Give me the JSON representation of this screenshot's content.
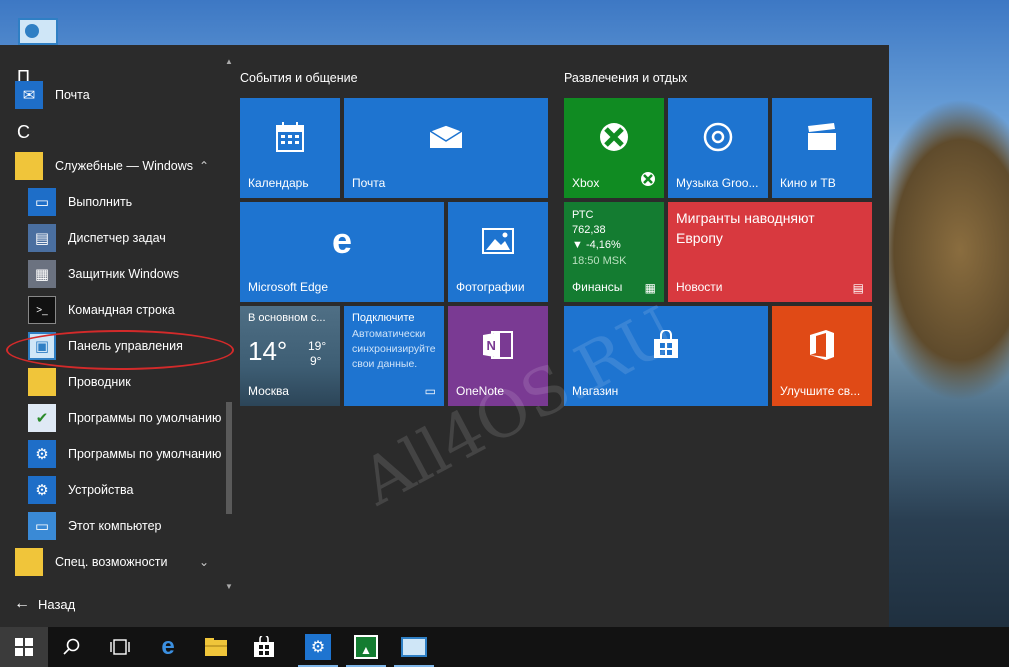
{
  "applist": {
    "letters": [
      "П",
      "С"
    ],
    "items": [
      {
        "label": "Почта",
        "icon": "mail-icon"
      },
      {
        "label": "Служебные — Windows",
        "icon": "folder-icon"
      },
      {
        "label": "Выполнить",
        "icon": "run-icon"
      },
      {
        "label": "Диспетчер задач",
        "icon": "task-manager-icon"
      },
      {
        "label": "Защитник Windows",
        "icon": "defender-icon"
      },
      {
        "label": "Командная строка",
        "icon": "cmd-icon"
      },
      {
        "label": "Панель управления",
        "icon": "control-panel-icon"
      },
      {
        "label": "Проводник",
        "icon": "explorer-icon"
      },
      {
        "label": "Программы по умолчанию",
        "icon": "default-programs-icon"
      },
      {
        "label": "Программы по умолчанию",
        "icon": "gear-icon"
      },
      {
        "label": "Устройства",
        "icon": "gear-icon"
      },
      {
        "label": "Этот компьютер",
        "icon": "computer-icon"
      },
      {
        "label": "Спец. возможности",
        "icon": "folder-icon"
      }
    ],
    "back_label": "Назад"
  },
  "groups": {
    "left_title": "События и общение",
    "right_title": "Развлечения и отдых"
  },
  "tiles": {
    "calendar": "Календарь",
    "mail": "Почта",
    "edge": "Microsoft Edge",
    "photos": "Фотографии",
    "weather": {
      "title": "В основном с...",
      "temp": "14°",
      "high": "19°",
      "low": "9°",
      "city": "Москва"
    },
    "connect": {
      "title": "Подключите",
      "text1": "Автоматически",
      "text2": "синхронизируйте",
      "text3": "свои данные."
    },
    "onenote": "OneNote",
    "xbox": "Xbox",
    "music": "Музыка Groo...",
    "movies": "Кино и ТВ",
    "finance": {
      "ticker": "РТС",
      "value": "762,38",
      "change": "▼ -4,16%",
      "time": "18:50 MSK",
      "name": "Финансы"
    },
    "news": {
      "headline": "Мигранты наводняют Европу",
      "name": "Новости"
    },
    "store": "Магазин",
    "office": "Улучшите св..."
  },
  "watermark": "All4OS.RU",
  "colors": {
    "tile_blue": "#1e74d0",
    "xbox_green": "#108b22",
    "news_red": "#d8393f",
    "office_orange": "#e04a16",
    "onenote_purple": "#7a3a93",
    "annotation_red": "#d32a2a"
  }
}
